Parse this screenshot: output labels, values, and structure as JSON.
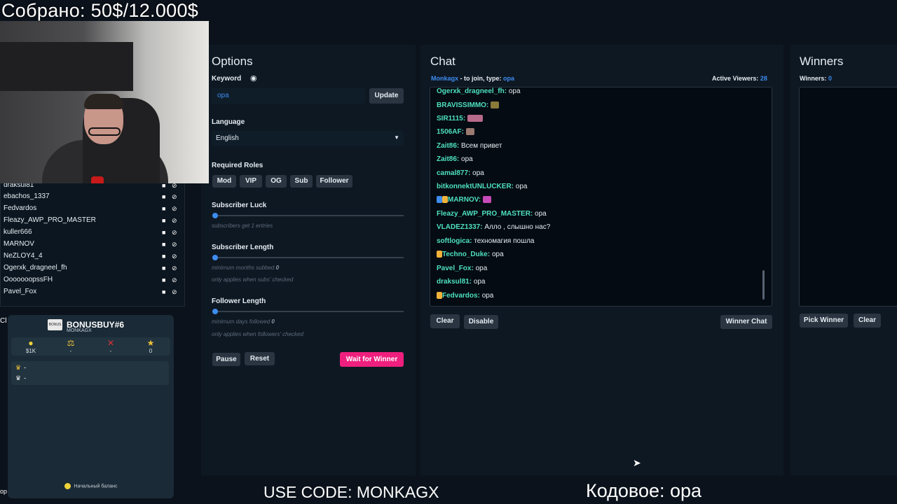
{
  "overlay": {
    "donation": "Собрано: 50$/12.000$",
    "use_code": "USE CODE: MONKAGX",
    "code_word": "Кодовое: ора"
  },
  "left_list": {
    "items": [
      {
        "name": "draksul81"
      },
      {
        "name": "ebachos_1337"
      },
      {
        "name": "Fedvardos"
      },
      {
        "name": "Fleazy_AWP_PRO_MASTER"
      },
      {
        "name": "kuller666"
      },
      {
        "name": "MARNOV"
      },
      {
        "name": "NeZLOY4_4"
      },
      {
        "name": "Ogerxk_dragneel_fh"
      },
      {
        "name": "OoooooopssFH"
      },
      {
        "name": "Pavel_Fox"
      }
    ],
    "cut_label_cl": "Cl",
    "cut_label_op": "op"
  },
  "bonus": {
    "icon_text": "BONUS",
    "title": "BONUSBUY#6",
    "subtitle": "MONKAGX",
    "stats": [
      {
        "icon": "coin-icon",
        "value": "$1K",
        "color": "#f0d33a"
      },
      {
        "icon": "scales-icon",
        "value": "-",
        "color": "#f0c23a"
      },
      {
        "icon": "cross-icon",
        "value": "-",
        "color": "#e0323a"
      },
      {
        "icon": "star-icon",
        "value": "0",
        "color": "#f0c23a"
      }
    ],
    "players": [
      "-",
      "-"
    ],
    "footer": "Начальный баланс"
  },
  "options": {
    "title": "Options",
    "keyword_label": "Keyword",
    "keyword_value": "opa",
    "update_label": "Update",
    "language_label": "Language",
    "language_value": "English",
    "roles_label": "Required Roles",
    "roles": [
      "Mod",
      "VIP",
      "OG",
      "Sub",
      "Follower"
    ],
    "sub_luck_label": "Subscriber Luck",
    "sub_luck_hint": "subscribers get 1 entries",
    "sub_length_label": "Subscriber Length",
    "sub_length_hint1": "minimum months subbed",
    "sub_length_value": "0",
    "sub_length_hint2": "only applies when subs' checked",
    "follow_length_label": "Follower Length",
    "follow_length_hint1": "minimum days followed",
    "follow_length_value": "0",
    "follow_length_hint2": "only applies when followers' checked",
    "pause_label": "Pause",
    "reset_label": "Reset",
    "wait_label": "Wait for Winner"
  },
  "chat": {
    "title": "Chat",
    "channel": "Monkagx",
    "join_text": " - to join, type: ",
    "join_keyword": "opa",
    "active_viewers_label": "Active Viewers:",
    "active_viewers_value": "28",
    "messages": [
      {
        "user": "Ogerxk_dragneel_fh:",
        "text": "opa"
      },
      {
        "user": "BRAVISSIMMO:",
        "text": ""
      },
      {
        "user": "SIR1115:",
        "text": ""
      },
      {
        "user": "1506AF:",
        "text": ""
      },
      {
        "user": "Zait86:",
        "text": "Всем привет"
      },
      {
        "user": "Zait86:",
        "text": "opa"
      },
      {
        "user": "camal877:",
        "text": "opa"
      },
      {
        "user": "bitkonnektUNLUCKER:",
        "text": "opa"
      },
      {
        "user": "MARNOV:",
        "text": ""
      },
      {
        "user": "Fleazy_AWP_PRO_MASTER:",
        "text": "opa"
      },
      {
        "user": "VLADEZ1337:",
        "text": "Алло , слышно нас?"
      },
      {
        "user": "softlogica:",
        "text": "техномагия пошла"
      },
      {
        "user": "Techno_Duke:",
        "text": "opa"
      },
      {
        "user": "Pavel_Fox:",
        "text": "opa"
      },
      {
        "user": "draksul81:",
        "text": "opa"
      },
      {
        "user": "Fedvardos:",
        "text": "opa"
      }
    ],
    "clear_label": "Clear",
    "disable_label": "Disable",
    "winner_chat_label": "Winner Chat"
  },
  "winners": {
    "title": "Winners",
    "count_label": "Winners:",
    "count_value": "0",
    "pick_label": "Pick Winner",
    "clear_label": "Clear"
  },
  "colors": {
    "accent_blue": "#3d8cf0",
    "username_teal": "#4ee0c0",
    "pink_button": "#ef1f7e",
    "background": "#0b121b"
  }
}
